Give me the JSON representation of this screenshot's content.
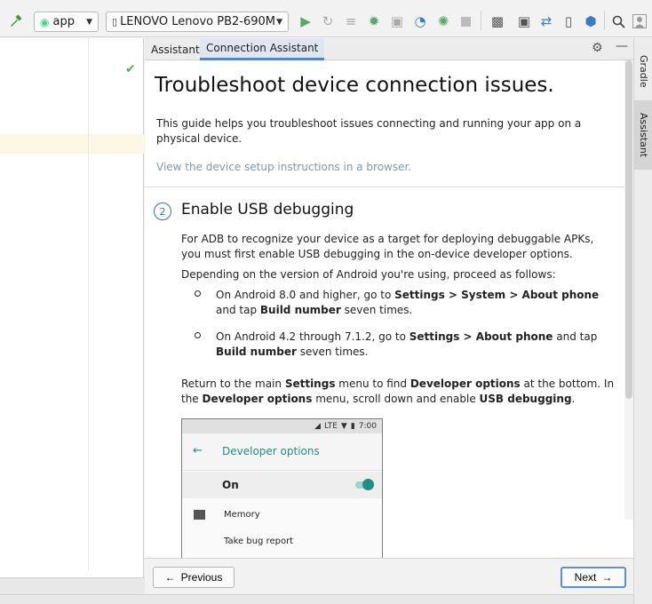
{
  "toolbar": {
    "run_config": "app",
    "device": "LENOVO Lenovo PB2-690M"
  },
  "tabs": [
    {
      "label": "Assistant"
    },
    {
      "label": "Connection Assistant"
    }
  ],
  "content": {
    "title": "Troubleshoot device connection issues.",
    "intro": "This guide helps you troubleshoot issues connecting and running your app on a physical device.",
    "link": "View the device setup instructions in a browser.",
    "step": {
      "number": "2",
      "title": "Enable USB debugging",
      "para1": "For ADB to recognize your device as a target for deploying debuggable APKs, you must first enable USB debugging in the on-device developer options.",
      "para2": "Depending on the version of Android you're using, proceed as follows:",
      "bullet1": {
        "a": "On Android 8.0 and higher, go to ",
        "b": "Settings > System > About phone",
        "c": " and tap ",
        "d": "Build number",
        "e": " seven times."
      },
      "bullet2": {
        "a": "On Android 4.2 through 7.1.2, go to ",
        "b": "Settings > About phone",
        "c": " and tap ",
        "d": "Build number",
        "e": " seven times."
      },
      "para3": {
        "a": "Return to the main ",
        "b": "Settings",
        "c": " menu to find ",
        "d": "Developer options",
        "e": " at the bottom. In the ",
        "f": "Developer options",
        "g": " menu, scroll down and enable ",
        "h": "USB debugging",
        "i": "."
      }
    }
  },
  "phone": {
    "status_net": "LTE",
    "time": "7:00",
    "title": "Developer options",
    "toggle_label": "On",
    "toggle_on": true,
    "items": [
      "Memory",
      "Take bug report"
    ]
  },
  "footer": {
    "previous": "Previous",
    "next": "Next"
  },
  "right_strip": {
    "gradle": "Gradle",
    "assistant": "Assistant"
  },
  "colors": {
    "accent": "#4a84d4",
    "teal": "#1f8f84",
    "run_green": "#59a869"
  }
}
